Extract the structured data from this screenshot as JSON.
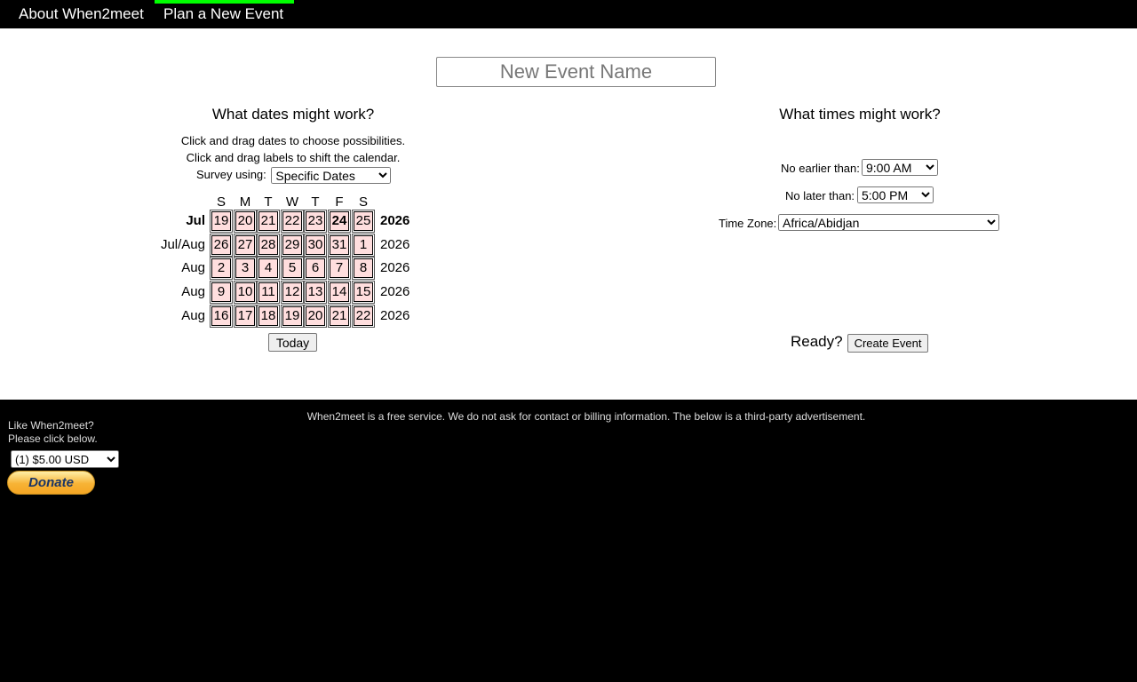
{
  "nav": {
    "about": "About When2meet",
    "plan": "Plan a New Event"
  },
  "event_name": {
    "placeholder": "New Event Name",
    "value": ""
  },
  "dates": {
    "heading": "What dates might work?",
    "instruction1": "Click and drag dates to choose possibilities.",
    "instruction2": "Click and drag labels to shift the calendar.",
    "survey_label": "Survey using:",
    "survey_selected": "Specific Dates",
    "days_of_week": [
      "S",
      "M",
      "T",
      "W",
      "T",
      "F",
      "S"
    ],
    "weeks": [
      {
        "month": "Jul",
        "year": "2026",
        "bold": true,
        "days": [
          "19",
          "20",
          "21",
          "22",
          "23",
          "24",
          "25"
        ]
      },
      {
        "month": "Jul/Aug",
        "year": "2026",
        "bold": false,
        "days": [
          "26",
          "27",
          "28",
          "29",
          "30",
          "31",
          "1"
        ]
      },
      {
        "month": "Aug",
        "year": "2026",
        "bold": false,
        "days": [
          "2",
          "3",
          "4",
          "5",
          "6",
          "7",
          "8"
        ]
      },
      {
        "month": "Aug",
        "year": "2026",
        "bold": false,
        "days": [
          "9",
          "10",
          "11",
          "12",
          "13",
          "14",
          "15"
        ]
      },
      {
        "month": "Aug",
        "year": "2026",
        "bold": false,
        "days": [
          "16",
          "17",
          "18",
          "19",
          "20",
          "21",
          "22"
        ]
      }
    ],
    "today_day": "24",
    "today_button": "Today"
  },
  "times": {
    "heading": "What times might work?",
    "earliest_label": "No earlier than:",
    "earliest_selected": "9:00 AM",
    "latest_label": "No later than:",
    "latest_selected": "5:00 PM",
    "timezone_label": "Time Zone:",
    "timezone_selected": "Africa/Abidjan",
    "ready_label": "Ready?",
    "create_button": "Create Event"
  },
  "footer": {
    "notice": "When2meet is a free service. We do not ask for contact or billing information. The below is a third-party advertisement.",
    "like_line1": "Like When2meet?",
    "like_line2": "Please click below.",
    "donate_selected": "(1) $5.00 USD",
    "donate_button": "Donate"
  },
  "colors": {
    "nav_active_bar": "#00ff00",
    "day_cell": "#ffdede",
    "background": "#000000"
  }
}
